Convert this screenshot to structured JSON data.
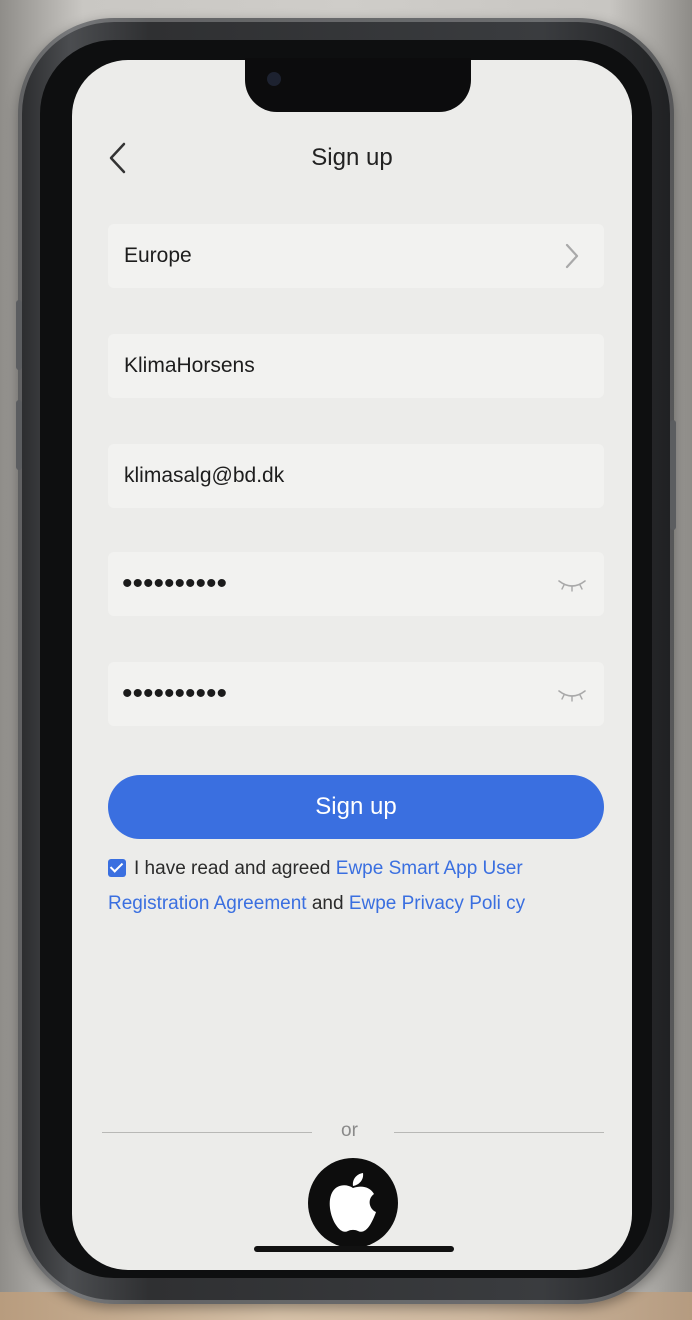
{
  "header": {
    "title": "Sign up",
    "back_icon": "chevron-left-icon"
  },
  "form": {
    "region": {
      "value": "Europe",
      "icon": "chevron-right-icon"
    },
    "username": {
      "value": "KlimaHorsens"
    },
    "email": {
      "value": "klimasalg@bd.dk"
    },
    "password": {
      "value": "••••••••••",
      "icon": "eye-closed-icon"
    },
    "confirm_password": {
      "value": "••••••••••",
      "icon": "eye-closed-icon"
    }
  },
  "signup_button": {
    "label": "Sign up"
  },
  "agreement": {
    "checked": true,
    "text_prefix": "I have read and agreed ",
    "link_terms": "Ewpe Smart App User Registration Agreement",
    "text_and": " and ",
    "link_privacy": "Ewpe Privacy Poli cy"
  },
  "divider": {
    "label": "or"
  },
  "social": {
    "apple_icon": "apple-logo-icon"
  },
  "colors": {
    "accent": "#3a6fe0",
    "background": "#ececea",
    "field": "#f2f2f0"
  }
}
